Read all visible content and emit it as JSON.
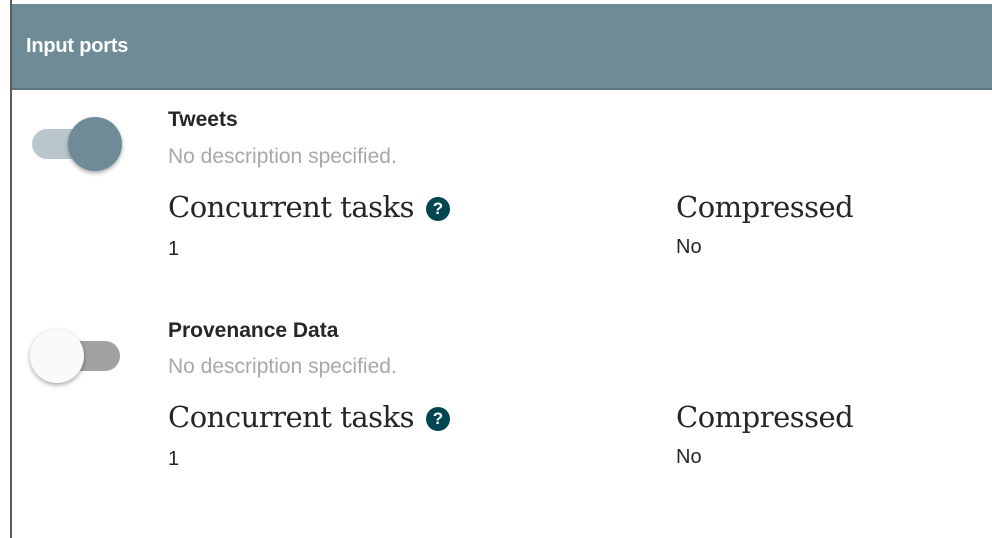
{
  "header": {
    "title": "Input ports"
  },
  "ports": [
    {
      "name": "Tweets",
      "description": "No description specified.",
      "enabled": true,
      "concurrent_tasks_label": "Concurrent tasks",
      "concurrent_tasks_help": "?",
      "concurrent_tasks_value": "1",
      "compressed_label": "Compressed",
      "compressed_value": "No"
    },
    {
      "name": "Provenance Data",
      "description": "No description specified.",
      "enabled": false,
      "concurrent_tasks_label": "Concurrent tasks",
      "concurrent_tasks_help": "?",
      "concurrent_tasks_value": "1",
      "compressed_label": "Compressed",
      "compressed_value": "No"
    }
  ],
  "colors": {
    "header_bg": "#6f8b97",
    "toggle_on_thumb": "#6f8b97",
    "toggle_on_track": "#b9c7cd",
    "toggle_off_track": "#a2a2a2",
    "help_icon": "#00454f"
  }
}
